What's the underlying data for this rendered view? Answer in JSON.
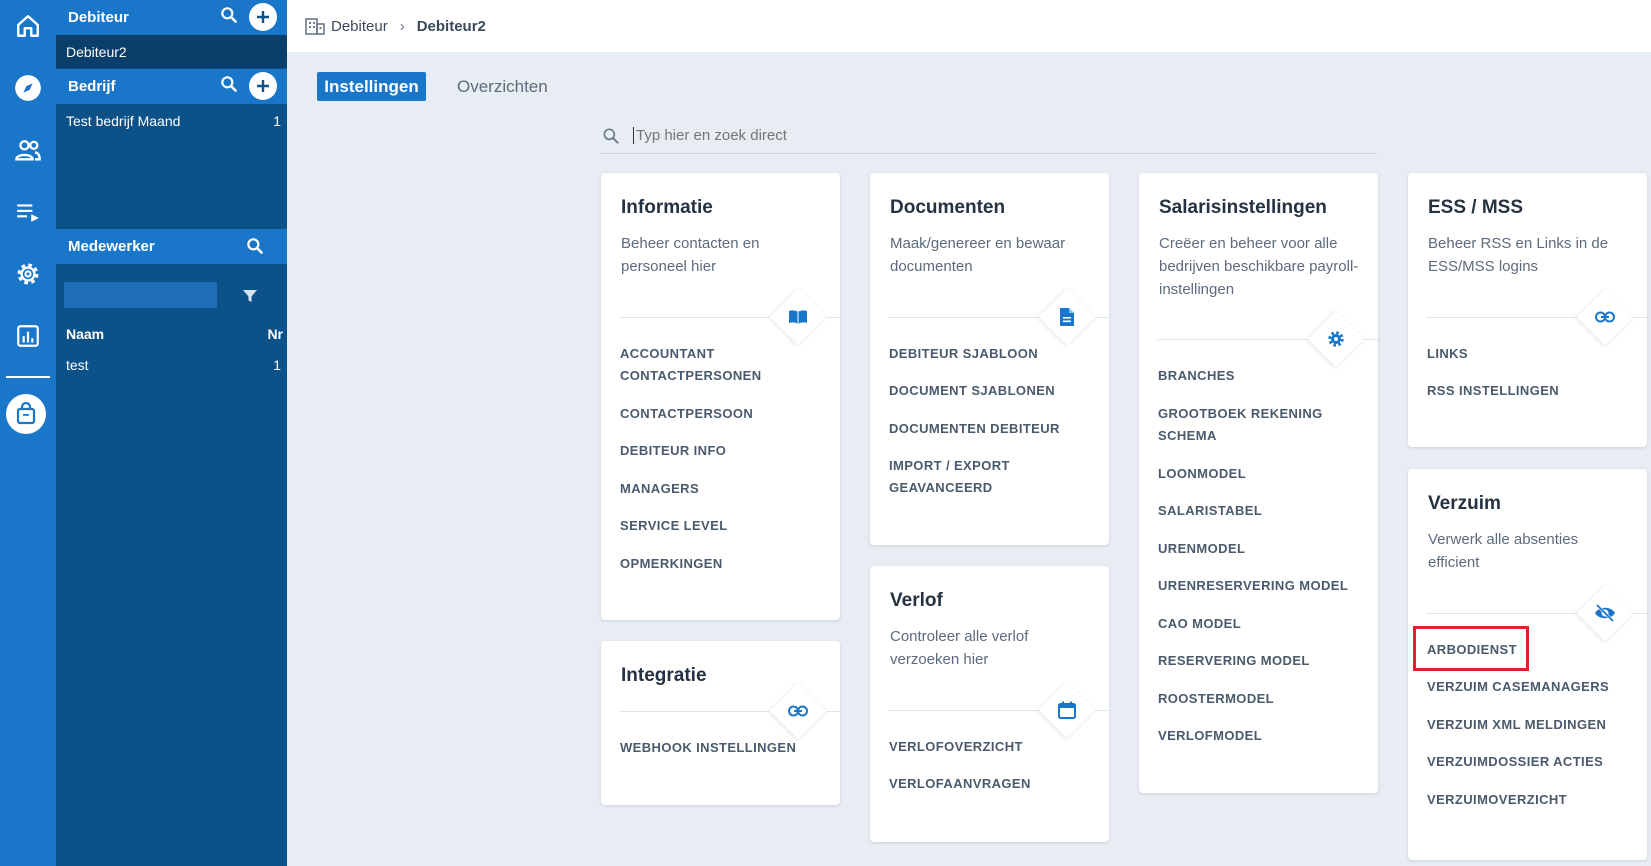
{
  "sidebar": {
    "debiteur": {
      "title": "Debiteur",
      "selected": "Debiteur2"
    },
    "bedrijf": {
      "title": "Bedrijf",
      "items": [
        {
          "name": "Test bedrijf Maand",
          "nr": "1"
        }
      ]
    },
    "medewerker": {
      "title": "Medewerker",
      "filter_value": "",
      "col_name": "Naam",
      "col_nr": "Nr",
      "rows": [
        {
          "name": "test",
          "nr": "1"
        }
      ]
    }
  },
  "breadcrumb": {
    "root": "Debiteur",
    "current": "Debiteur2"
  },
  "tabs": [
    {
      "label": "Instellingen",
      "active": true
    },
    {
      "label": "Overzichten",
      "active": false
    }
  ],
  "search": {
    "placeholder": "Typ hier en zoek direct"
  },
  "cards": {
    "informatie": {
      "title": "Informatie",
      "desc": "Beheer contacten en personeel hier",
      "icon": "book-icon",
      "links": [
        "ACCOUNTANT CONTACTPERSONEN",
        "CONTACTPERSOON",
        "DEBITEUR INFO",
        "MANAGERS",
        "SERVICE LEVEL",
        "OPMERKINGEN"
      ]
    },
    "integratie": {
      "title": "Integratie",
      "icon": "link-icon",
      "links": [
        "WEBHOOK INSTELLINGEN"
      ]
    },
    "documenten": {
      "title": "Documenten",
      "desc": "Maak/genereer en bewaar documenten",
      "icon": "document-icon",
      "links": [
        "DEBITEUR SJABLOON",
        "DOCUMENT SJABLONEN",
        "DOCUMENTEN DEBITEUR",
        "IMPORT / EXPORT GEAVANCEERD"
      ]
    },
    "verlof": {
      "title": "Verlof",
      "desc": "Controleer alle verlof verzoeken hier",
      "icon": "calendar-icon",
      "links": [
        "VERLOFOVERZICHT",
        "VERLOFAANVRAGEN"
      ]
    },
    "salaris": {
      "title": "Salarisinstellingen",
      "desc": "Creëer en beheer voor alle bedrijven beschikbare payroll-instellingen",
      "icon": "gear-icon",
      "links": [
        "BRANCHES",
        "GROOTBOEK REKENING SCHEMA",
        "LOONMODEL",
        "SALARISTABEL",
        "URENMODEL",
        "URENRESERVERING MODEL",
        "CAO MODEL",
        "RESERVERING MODEL",
        "ROOSTERMODEL",
        "VERLOFMODEL"
      ]
    },
    "ess": {
      "title": "ESS / MSS",
      "desc": "Beheer RSS en Links in de ESS/MSS logins",
      "icon": "link-icon",
      "links": [
        "LINKS",
        "RSS INSTELLINGEN"
      ]
    },
    "verzuim": {
      "title": "Verzuim",
      "desc": "Verwerk alle absenties efficient",
      "icon": "eye-off-icon",
      "links": [
        "ARBODIENST",
        "VERZUIM CASEMANAGERS",
        "VERZUIM XML MELDINGEN",
        "VERZUIMDOSSIER ACTIES",
        "VERZUIMOVERZICHT"
      ]
    }
  },
  "colors": {
    "primary": "#1976c9",
    "panel": "#0d5189",
    "highlight": "#e0202a"
  }
}
